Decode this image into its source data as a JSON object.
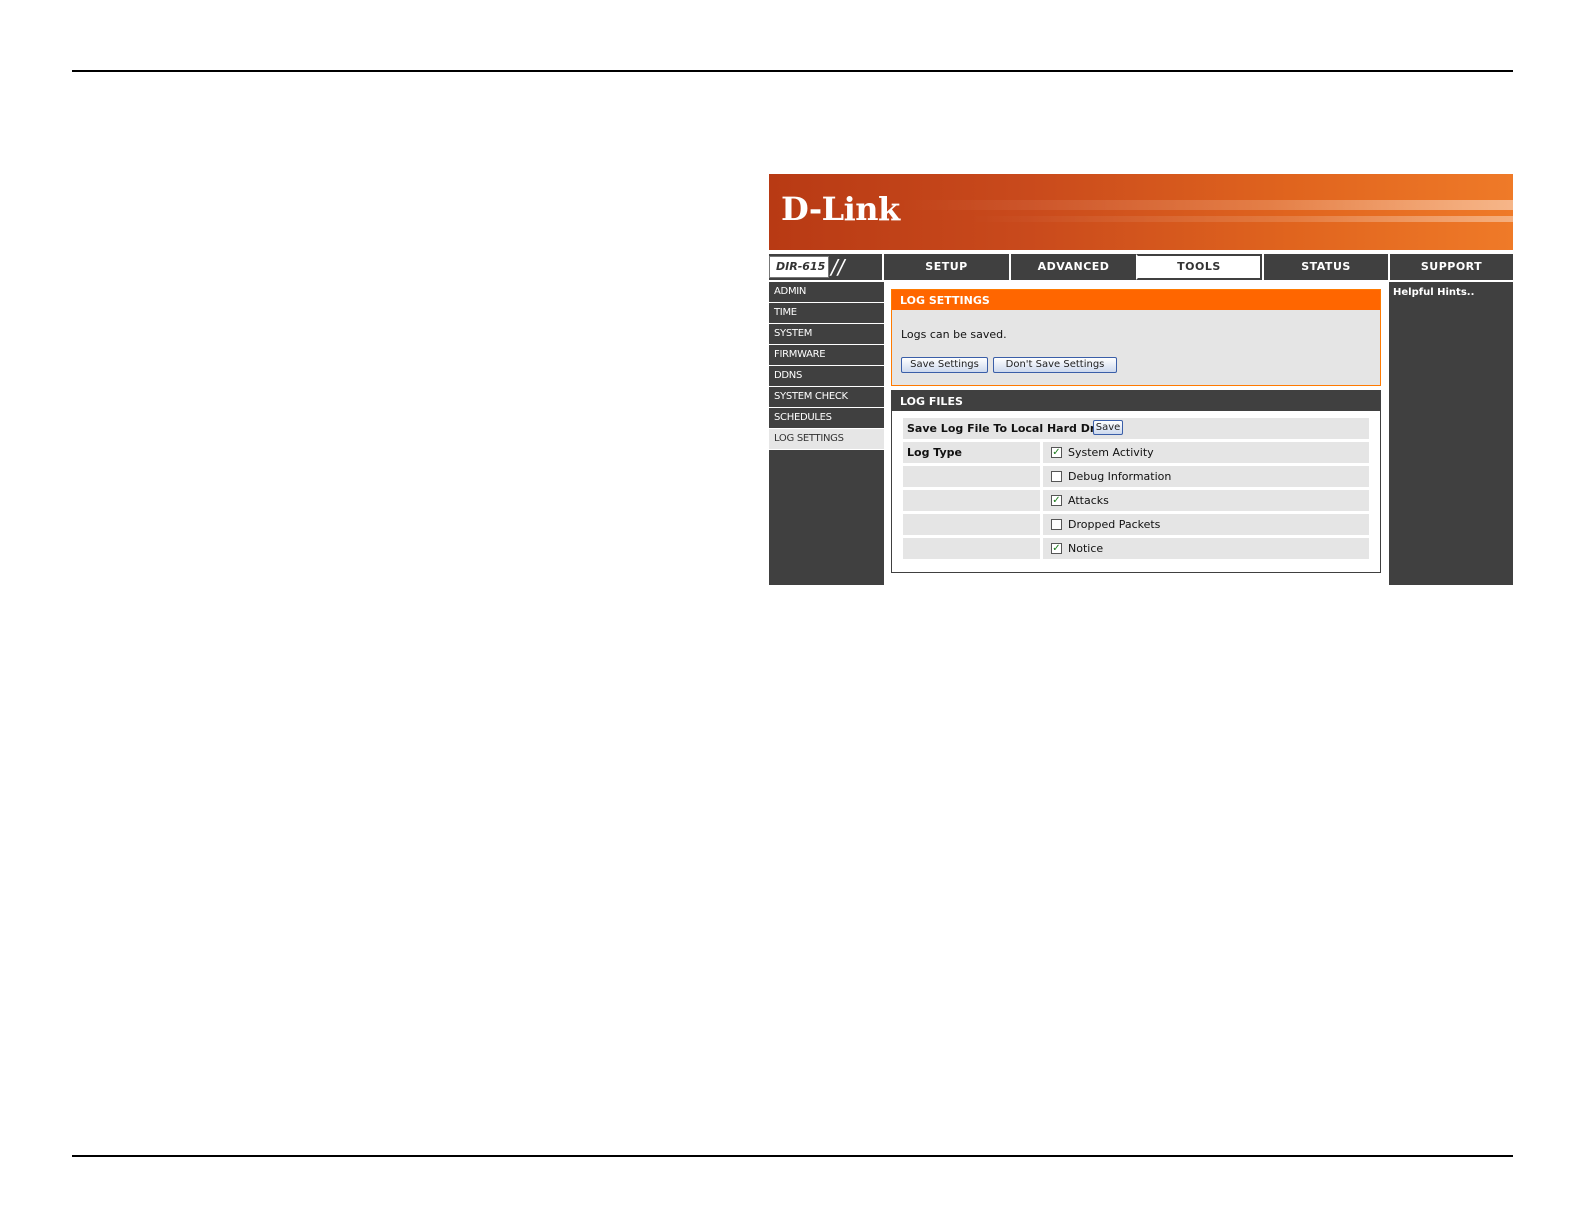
{
  "brand": {
    "logo": "D-Link",
    "model": "DIR-615",
    "slashes": "//"
  },
  "tabs": [
    {
      "label": "SETUP",
      "active": false
    },
    {
      "label": "ADVANCED",
      "active": false
    },
    {
      "label": "TOOLS",
      "active": true
    },
    {
      "label": "STATUS",
      "active": false
    },
    {
      "label": "SUPPORT",
      "active": false
    }
  ],
  "sidebar": {
    "items": [
      {
        "label": "ADMIN"
      },
      {
        "label": "TIME"
      },
      {
        "label": "SYSTEM"
      },
      {
        "label": "FIRMWARE"
      },
      {
        "label": "DDNS"
      },
      {
        "label": "SYSTEM CHECK"
      },
      {
        "label": "SCHEDULES"
      },
      {
        "label": "LOG SETTINGS",
        "active": true
      }
    ]
  },
  "log_settings": {
    "title": "LOG SETTINGS",
    "message": "Logs can be saved.",
    "save_button": "Save Settings",
    "dont_save_button": "Don't Save Settings"
  },
  "log_files": {
    "title": "LOG FILES",
    "save_label": "Save Log File To Local Hard Drive",
    "save_button": "Save",
    "log_type_label": "Log Type",
    "options": [
      {
        "label": "System Activity",
        "checked": true
      },
      {
        "label": "Debug Information",
        "checked": false
      },
      {
        "label": "Attacks",
        "checked": true
      },
      {
        "label": "Dropped Packets",
        "checked": false
      },
      {
        "label": "Notice",
        "checked": true
      }
    ]
  },
  "hints": {
    "title": "Helpful Hints.."
  },
  "colors": {
    "accent": "#ff6600",
    "dark": "#404040",
    "panel": "#e5e5e5"
  }
}
